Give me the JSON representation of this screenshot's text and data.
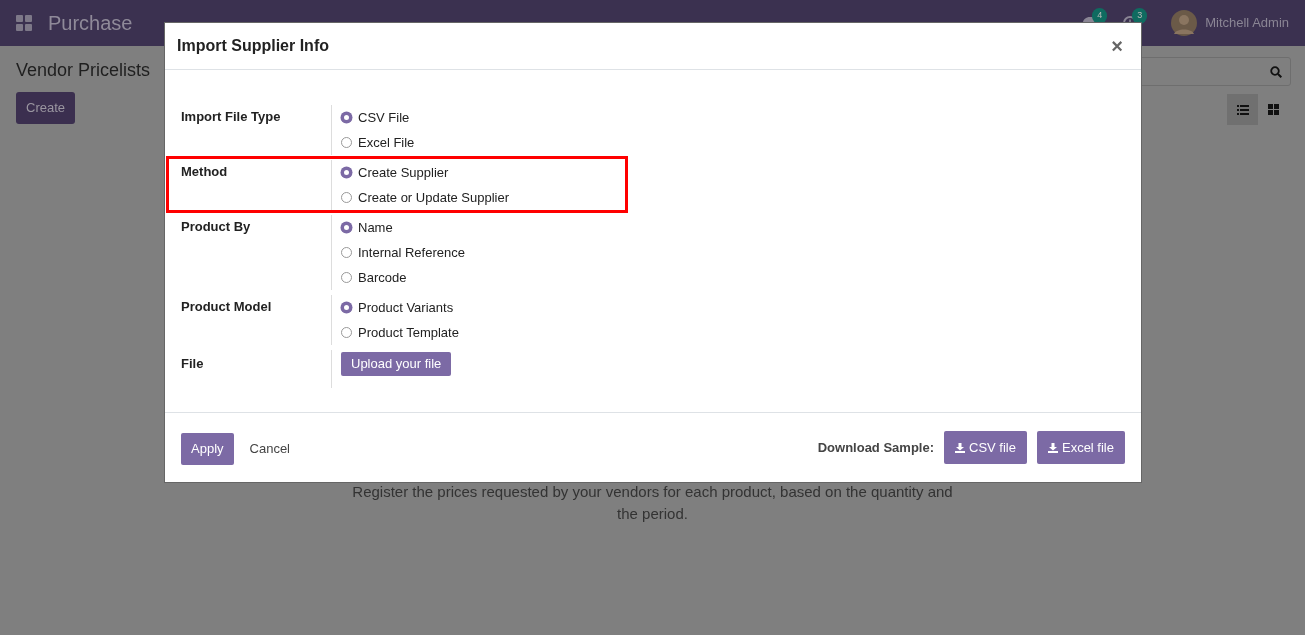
{
  "app": {
    "name": "Purchase",
    "messages_badge": "4",
    "activities_badge": "3",
    "user": "Mitchell Admin"
  },
  "page": {
    "title": "Vendor Pricelists",
    "create_button": "Create",
    "views": [
      {
        "kind": "list",
        "selected": true
      },
      {
        "kind": "kanban",
        "selected": false
      }
    ],
    "help_text": "Register the prices requested by your vendors for each product, based on the quantity and the period."
  },
  "dialog": {
    "title": "Import Supplier Info",
    "close": "×",
    "fields": [
      {
        "label": "Import File Type",
        "kind": "radio",
        "highlighted": false,
        "options": [
          {
            "label": "CSV File",
            "selected": true
          },
          {
            "label": "Excel File",
            "selected": false
          }
        ]
      },
      {
        "label": "Method",
        "kind": "radio",
        "highlighted": true,
        "options": [
          {
            "label": "Create Supplier",
            "selected": true
          },
          {
            "label": "Create or Update Supplier",
            "selected": false
          }
        ]
      },
      {
        "label": "Product By",
        "kind": "radio",
        "highlighted": false,
        "options": [
          {
            "label": "Name",
            "selected": true
          },
          {
            "label": "Internal Reference",
            "selected": false
          },
          {
            "label": "Barcode",
            "selected": false
          }
        ]
      },
      {
        "label": "Product Model",
        "kind": "radio",
        "highlighted": false,
        "options": [
          {
            "label": "Product Variants",
            "selected": true
          },
          {
            "label": "Product Template",
            "selected": false
          }
        ]
      },
      {
        "label": "File",
        "kind": "upload",
        "highlighted": false,
        "button": "Upload your file"
      }
    ],
    "apply": "Apply",
    "cancel": "Cancel",
    "sample_label": "Download Sample:",
    "sample_buttons": [
      "CSV file",
      "Excel file"
    ]
  }
}
